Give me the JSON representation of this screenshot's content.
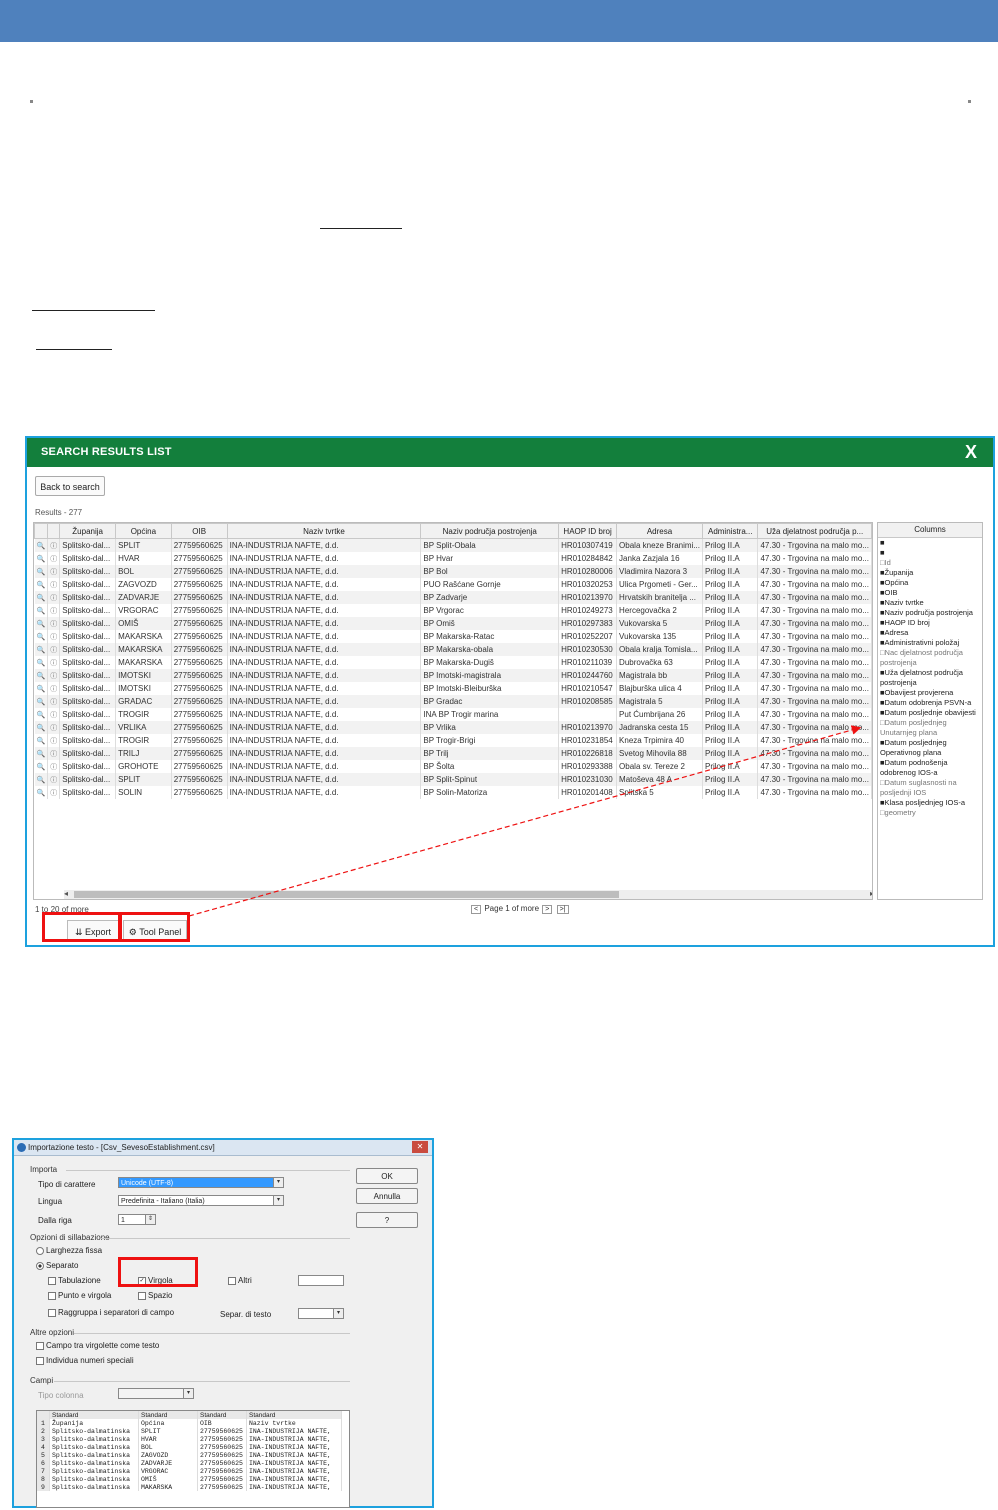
{
  "results_panel": {
    "title": "SEARCH RESULTS LIST",
    "close_label": "X",
    "back_button": "Back to search",
    "results_label": "Results - 277",
    "columns": [
      "",
      "",
      "Županija",
      "Općina",
      "OIB",
      "Naziv tvrtke",
      "Naziv područja postrojenja",
      "HAOP ID broj",
      "Adresa",
      "Administra...",
      "Uža djelatnost područja p..."
    ],
    "rows": [
      [
        "Splitsko-dal...",
        "SPLIT",
        "27759560625",
        "INA-INDUSTRIJA NAFTE, d.d.",
        "BP Split-Obala",
        "HR010307419",
        "Obala kneze Branimi...",
        "Prilog II.A",
        "47.30 - Trgovina na malo mo..."
      ],
      [
        "Splitsko-dal...",
        "HVAR",
        "27759560625",
        "INA-INDUSTRIJA NAFTE, d.d.",
        "BP Hvar",
        "HR010284842",
        "Janka Zazjala 16",
        "Prilog II.A",
        "47.30 - Trgovina na malo mo..."
      ],
      [
        "Splitsko-dal...",
        "BOL",
        "27759560625",
        "INA-INDUSTRIJA NAFTE, d.d.",
        "BP Bol",
        "HR010280006",
        "Vladimira Nazora 3",
        "Prilog II.A",
        "47.30 - Trgovina na malo mo..."
      ],
      [
        "Splitsko-dal...",
        "ZAGVOZD",
        "27759560625",
        "INA-INDUSTRIJA NAFTE, d.d.",
        "PUO Rašćane Gornje",
        "HR010320253",
        "Ulica Prgometi - Ger...",
        "Prilog II.A",
        "47.30 - Trgovina na malo mo..."
      ],
      [
        "Splitsko-dal...",
        "ZADVARJE",
        "27759560625",
        "INA-INDUSTRIJA NAFTE, d.d.",
        "BP Zadvarje",
        "HR010213970",
        "Hrvatskih branitelja ...",
        "Prilog II.A",
        "47.30 - Trgovina na malo mo..."
      ],
      [
        "Splitsko-dal...",
        "VRGORAC",
        "27759560625",
        "INA-INDUSTRIJA NAFTE, d.d.",
        "BP Vrgorac",
        "HR010249273",
        "Hercegovačka 2",
        "Prilog II.A",
        "47.30 - Trgovina na malo mo..."
      ],
      [
        "Splitsko-dal...",
        "OMIŠ",
        "27759560625",
        "INA-INDUSTRIJA NAFTE, d.d.",
        "BP Omiš",
        "HR010297383",
        "Vukovarska 5",
        "Prilog II.A",
        "47.30 - Trgovina na malo mo..."
      ],
      [
        "Splitsko-dal...",
        "MAKARSKA",
        "27759560625",
        "INA-INDUSTRIJA NAFTE, d.d.",
        "BP Makarska-Ratac",
        "HR010252207",
        "Vukovarska 135",
        "Prilog II.A",
        "47.30 - Trgovina na malo mo..."
      ],
      [
        "Splitsko-dal...",
        "MAKARSKA",
        "27759560625",
        "INA-INDUSTRIJA NAFTE, d.d.",
        "BP Makarska-obala",
        "HR010230530",
        "Obala kralja Tomisla...",
        "Prilog II.A",
        "47.30 - Trgovina na malo mo..."
      ],
      [
        "Splitsko-dal...",
        "MAKARSKA",
        "27759560625",
        "INA-INDUSTRIJA NAFTE, d.d.",
        "BP Makarska-Dugiš",
        "HR010211039",
        "Dubrovačka 63",
        "Prilog II.A",
        "47.30 - Trgovina na malo mo..."
      ],
      [
        "Splitsko-dal...",
        "IMOTSKI",
        "27759560625",
        "INA-INDUSTRIJA NAFTE, d.d.",
        "BP Imotski-magistrala",
        "HR010244760",
        "Magistrala bb",
        "Prilog II.A",
        "47.30 - Trgovina na malo mo..."
      ],
      [
        "Splitsko-dal...",
        "IMOTSKI",
        "27759560625",
        "INA-INDUSTRIJA NAFTE, d.d.",
        "BP Imotski-Bleiburška",
        "HR010210547",
        "Blajburška ulica 4",
        "Prilog II.A",
        "47.30 - Trgovina na malo mo..."
      ],
      [
        "Splitsko-dal...",
        "GRADAC",
        "27759560625",
        "INA-INDUSTRIJA NAFTE, d.d.",
        "BP Gradac",
        "HR010208585",
        "Magistrala 5",
        "Prilog II.A",
        "47.30 - Trgovina na malo mo..."
      ],
      [
        "Splitsko-dal...",
        "TROGIR",
        "27759560625",
        "INA-INDUSTRIJA NAFTE, d.d.",
        "INA BP Trogir marina",
        "",
        "Put Ćumbrijana 26",
        "Prilog II.A",
        "47.30 - Trgovina na malo mo..."
      ],
      [
        "Splitsko-dal...",
        "VRLIKA",
        "27759560625",
        "INA-INDUSTRIJA NAFTE, d.d.",
        "BP Vrlika",
        "HR010213970",
        "Jadranska cesta 15",
        "Prilog II.A",
        "47.30 - Trgovina na malo mo..."
      ],
      [
        "Splitsko-dal...",
        "TROGIR",
        "27759560625",
        "INA-INDUSTRIJA NAFTE, d.d.",
        "BP Trogir-Brigi",
        "HR010231854",
        "Kneza Trpimira 40",
        "Prilog II.A",
        "47.30 - Trgovina na malo mo..."
      ],
      [
        "Splitsko-dal...",
        "TRILJ",
        "27759560625",
        "INA-INDUSTRIJA NAFTE, d.d.",
        "BP Trilj",
        "HR010226818",
        "Svetog Mihovila 88",
        "Prilog II.A",
        "47.30 - Trgovina na malo mo..."
      ],
      [
        "Splitsko-dal...",
        "GROHOTE",
        "27759560625",
        "INA-INDUSTRIJA NAFTE, d.d.",
        "BP Šolta",
        "HR010293388",
        "Obala sv. Tereze 2",
        "Prilog II.A",
        "47.30 - Trgovina na malo mo..."
      ],
      [
        "Splitsko-dal...",
        "SPLIT",
        "27759560625",
        "INA-INDUSTRIJA NAFTE, d.d.",
        "BP Split-Spinut",
        "HR010231030",
        "Matoševa 48 A",
        "Prilog II.A",
        "47.30 - Trgovina na malo mo..."
      ],
      [
        "Splitsko-dal...",
        "SOLIN",
        "27759560625",
        "INA-INDUSTRIJA NAFTE, d.d.",
        "BP Solin-Matoriza",
        "HR010201408",
        "Splitska 5",
        "Prilog II.A",
        "47.30 - Trgovina na malo mo..."
      ]
    ],
    "column_panel": {
      "title": "Columns",
      "items": [
        {
          "label": "",
          "checked": true
        },
        {
          "label": "",
          "checked": true
        },
        {
          "label": "Id",
          "checked": false
        },
        {
          "label": "Županija",
          "checked": true
        },
        {
          "label": "Općina",
          "checked": true
        },
        {
          "label": "OIB",
          "checked": true
        },
        {
          "label": "Naziv tvrtke",
          "checked": true
        },
        {
          "label": "Naziv područja postrojenja",
          "checked": true
        },
        {
          "label": "HAOP ID broj",
          "checked": true
        },
        {
          "label": "Adresa",
          "checked": true
        },
        {
          "label": "Administrativni položaj",
          "checked": true
        },
        {
          "label": "Nac djelatnost područja postrojenja",
          "checked": false
        },
        {
          "label": "Uža djelatnost područja postrojenja",
          "checked": true
        },
        {
          "label": "Obavijest provjerena",
          "checked": true
        },
        {
          "label": "Datum odobrenja PSVN-a",
          "checked": true
        },
        {
          "label": "Datum posljednje obavijesti",
          "checked": true
        },
        {
          "label": "Datum posljednjeg Unutarnjeg plana",
          "checked": false
        },
        {
          "label": "Datum posljednjeg Operativnog plana",
          "checked": true
        },
        {
          "label": "Datum podnošenja odobrenog IOS-a",
          "checked": true
        },
        {
          "label": "Datum suglasnosti na posljednji IOS",
          "checked": false
        },
        {
          "label": "Klasa posljednjeg IOS-a",
          "checked": true
        },
        {
          "label": "geometry",
          "checked": false
        }
      ]
    },
    "footer_text": "1 to 20 of more",
    "pager": {
      "prev": "<",
      "label": "Page 1 of more",
      "next": ">",
      "last": ">|"
    },
    "export_button": "Export",
    "tool_panel_button": "Tool Panel"
  },
  "import_dialog": {
    "title": "Importazione testo - [Csv_SevesoEstablishment.csv]",
    "section_import": "Importa",
    "charset_label": "Tipo di carattere",
    "charset_value": "Unicode (UTF-8)",
    "language_label": "Lingua",
    "language_value": "Predefinita - Italiano (Italia)",
    "from_row_label": "Dalla riga",
    "from_row_value": "1",
    "section_separator": "Opzioni di sillabazione",
    "fixed_width": "Larghezza fissa",
    "separated": "Separato",
    "tab": "Tabulazione",
    "comma": "Virgola",
    "other": "Altri",
    "semicolon": "Punto e virgola",
    "space": "Spazio",
    "merge": "Raggruppa i separatori di campo",
    "text_sep_label": "Separ. di testo",
    "section_other": "Altre opzioni",
    "quoted_as_text": "Campo tra virgolette come testo",
    "detect_numbers": "Individua numeri speciali",
    "section_fields": "Campi",
    "column_type_label": "Tipo colonna",
    "ok": "OK",
    "cancel": "Annulla",
    "help": "?",
    "preview_header": [
      "Standard",
      "Standard",
      "Standard",
      "Standard"
    ],
    "preview_rows": [
      [
        "1",
        "Županija",
        "Općina",
        "OIB",
        "Naziv tvrtke"
      ],
      [
        "2",
        "Splitsko-dalmatinska",
        "SPLIT",
        "27759560625",
        "INA-INDUSTRIJA NAFTE,"
      ],
      [
        "3",
        "Splitsko-dalmatinska",
        "HVAR",
        "27759560625",
        "INA-INDUSTRIJA NAFTE,"
      ],
      [
        "4",
        "Splitsko-dalmatinska",
        "BOL",
        "27759560625",
        "INA-INDUSTRIJA NAFTE,"
      ],
      [
        "5",
        "Splitsko-dalmatinska",
        "ZAGVOZD",
        "27759560625",
        "INA-INDUSTRIJA NAFTE,"
      ],
      [
        "6",
        "Splitsko-dalmatinska",
        "ZADVARJE",
        "27759560625",
        "INA-INDUSTRIJA NAFTE,"
      ],
      [
        "7",
        "Splitsko-dalmatinska",
        "VRGORAC",
        "27759560625",
        "INA-INDUSTRIJA NAFTE,"
      ],
      [
        "8",
        "Splitsko-dalmatinska",
        "OMIŠ",
        "27759560625",
        "INA-INDUSTRIJA NAFTE,"
      ],
      [
        "9",
        "Splitsko-dalmatinska",
        "MAKARSKA",
        "27759560625",
        "INA-INDUSTRIJA NAFTE,"
      ]
    ]
  }
}
